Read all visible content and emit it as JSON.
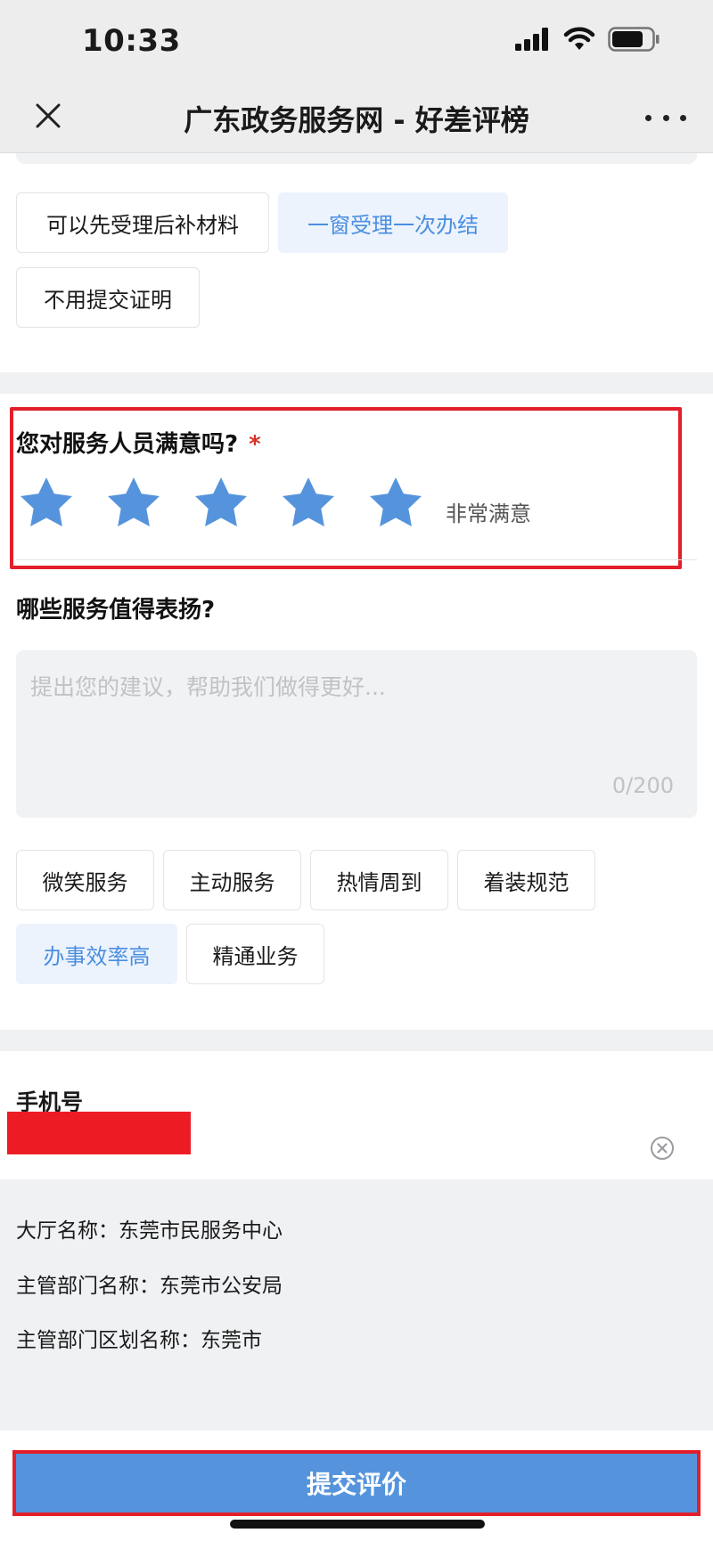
{
  "status_bar": {
    "time": "10:33"
  },
  "nav": {
    "title": "广东政务服务网 - 好差评榜"
  },
  "service_tags": [
    {
      "label": "可以先受理后补材料",
      "selected": false
    },
    {
      "label": "一窗受理一次办结",
      "selected": true
    },
    {
      "label": "不用提交证明",
      "selected": false
    }
  ],
  "staff_question": {
    "title": "您对服务人员满意吗?",
    "required_mark": "*",
    "rating": 5,
    "rating_max": 5,
    "rating_label": "非常满意",
    "star_color": "#5594dc"
  },
  "praise_question": {
    "title": "哪些服务值得表扬?",
    "placeholder": "提出您的建议，帮助我们做得更好...",
    "value": "",
    "counter": "0/200"
  },
  "praise_tags": [
    {
      "label": "微笑服务",
      "selected": false
    },
    {
      "label": "主动服务",
      "selected": false
    },
    {
      "label": "热情周到",
      "selected": false
    },
    {
      "label": "着装规范",
      "selected": false
    },
    {
      "label": "办事效率高",
      "selected": true
    },
    {
      "label": "精通业务",
      "selected": false
    }
  ],
  "phone": {
    "label": "手机号",
    "value": ""
  },
  "info": {
    "hall": "大厅名称：东莞市民服务中心",
    "department": "主管部门名称：东莞市公安局",
    "district": "主管部门区划名称：东莞市"
  },
  "submit": {
    "label": "提交评价"
  },
  "colors": {
    "accent": "#5594dc",
    "selected_tag_bg": "#ecf3fd",
    "selected_tag_text": "#4a8ee0",
    "annotation_red": "#e21f2a"
  }
}
